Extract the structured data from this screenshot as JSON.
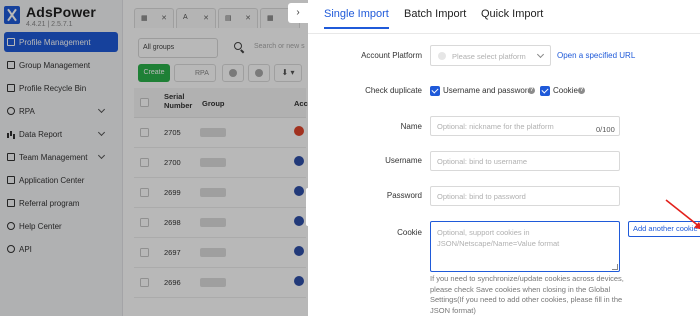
{
  "app": {
    "name": "AdsPower",
    "version": "4.4.21 | 2.5.7.1"
  },
  "sidebar": {
    "items": [
      {
        "label": "Profile Management",
        "active": true,
        "icon": "profile-icon"
      },
      {
        "label": "Group Management",
        "icon": "group-icon"
      },
      {
        "label": "Profile Recycle Bin",
        "icon": "recycle-bin-icon"
      },
      {
        "label": "RPA",
        "icon": "rpa-icon",
        "expandable": true
      },
      {
        "label": "Data Report",
        "icon": "report-icon",
        "expandable": true
      },
      {
        "label": "Team Management",
        "icon": "team-icon",
        "expandable": true
      },
      {
        "label": "Application Center",
        "icon": "app-center-icon"
      },
      {
        "label": "Referral program",
        "icon": "referral-icon"
      },
      {
        "label": "Help Center",
        "icon": "help-icon"
      },
      {
        "label": "API",
        "icon": "api-icon"
      }
    ]
  },
  "main": {
    "groups_select": "All groups",
    "search_placeholder": "Search or new s",
    "create_label": "Create",
    "rpa_label": "RPA",
    "table": {
      "headers": [
        "Serial Number",
        "Group",
        "Acc"
      ],
      "rows": [
        {
          "serial": "2705",
          "account_icon": "red-account-icon"
        },
        {
          "serial": "2700",
          "account_icon": "facebook-icon"
        },
        {
          "serial": "2699",
          "account_icon": "facebook-icon"
        },
        {
          "serial": "2698",
          "account_icon": "facebook-icon"
        },
        {
          "serial": "2697",
          "account_icon": "facebook-icon"
        },
        {
          "serial": "2696",
          "account_icon": "facebook-icon"
        }
      ]
    }
  },
  "drawer": {
    "collapse_glyph": "›",
    "tabs": [
      "Single Import",
      "Batch Import",
      "Quick Import"
    ],
    "active_tab": "Single Import",
    "account_platform": {
      "label": "Account Platform",
      "placeholder": "Please select platform",
      "link": "Open a specified URL"
    },
    "check_duplicate": {
      "label": "Check duplicate",
      "option1": "Username and password",
      "option2": "Cookie",
      "help_glyph": "?"
    },
    "name": {
      "label": "Name",
      "placeholder": "Optional: nickname for the platform",
      "counter": "0/100"
    },
    "username": {
      "label": "Username",
      "placeholder": "Optional: bind to username"
    },
    "password": {
      "label": "Password",
      "placeholder": "Optional: bind to password"
    },
    "cookie": {
      "label": "Cookie",
      "placeholder": "Optional, support cookies in JSON/Netscape/Name=Value format",
      "add_button": "Add another cookie",
      "help": "If you need to synchronize/update cookies across devices, please check Save cookies when closing in the Global Settings(If you need to add other cookies, please fill in the JSON format)"
    }
  },
  "colors": {
    "accent": "#1f5ad9",
    "create_green": "#2bb24c",
    "arrow_red": "#e3211c"
  }
}
